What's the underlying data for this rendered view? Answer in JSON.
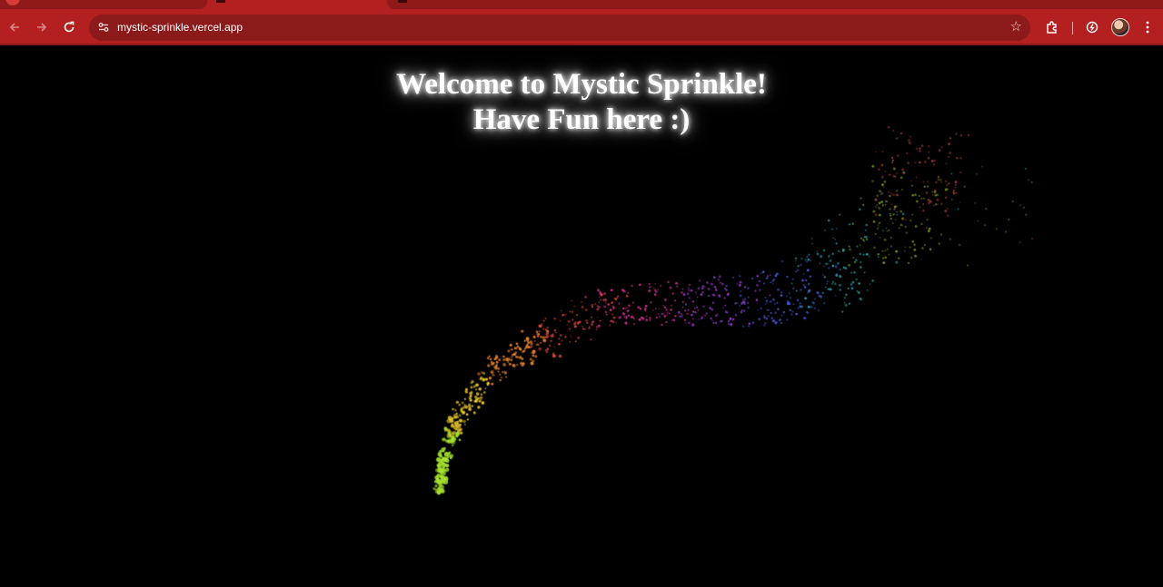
{
  "browser": {
    "url": "mystic-sprinkle.vercel.app",
    "icons": {
      "back": "back-arrow-icon",
      "forward": "forward-arrow-icon",
      "reload": "reload-icon",
      "site_info": "site-info-icon",
      "bookmark": "star-icon",
      "extensions": "puzzle-icon",
      "performance": "performance-icon",
      "profile": "avatar",
      "menu": "kebab-menu-icon"
    },
    "colors": {
      "frame": "#b3201f",
      "omnibox": "#8d1a1a"
    }
  },
  "page": {
    "heading_line1": "Welcome to Mystic Sprinkle!",
    "heading_line2": "Have Fun here :)",
    "background": "#000000",
    "sprinkle_trail": {
      "colors": [
        "#a6e22e",
        "#e8c52b",
        "#e8842b",
        "#e84a3c",
        "#e0369a",
        "#a93ee0",
        "#4a5fe0",
        "#2ea7b0",
        "#7a9a2a",
        "#9a3a30"
      ]
    }
  }
}
